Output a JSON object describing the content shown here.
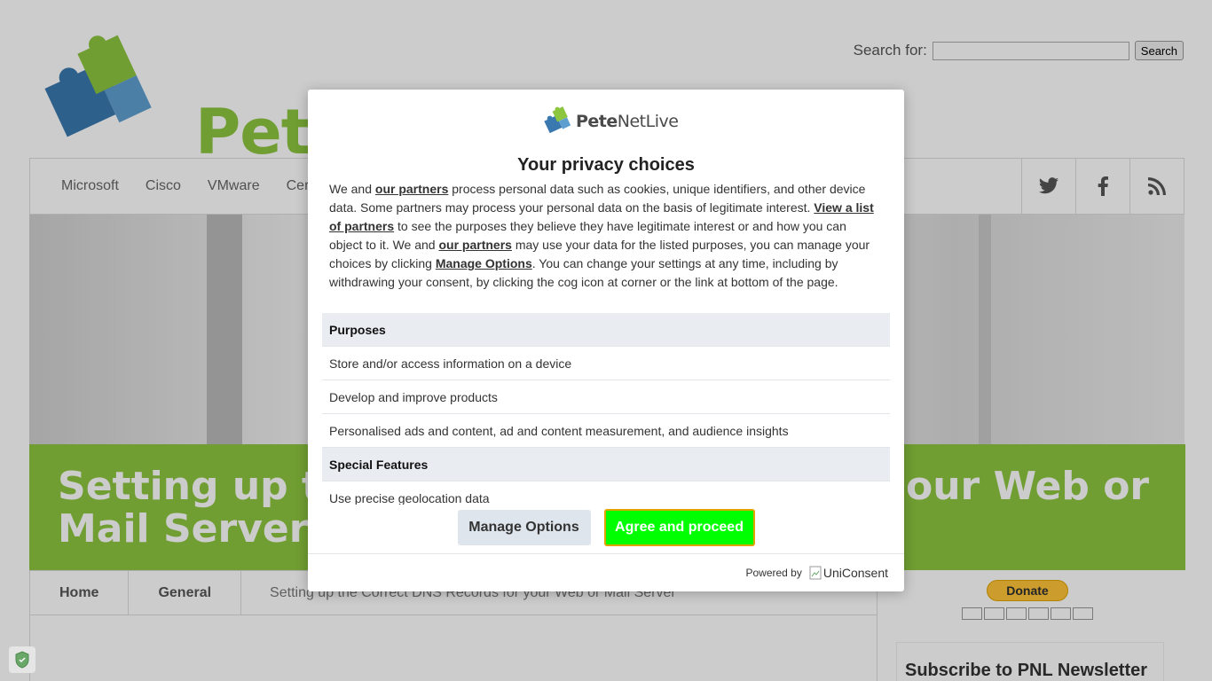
{
  "site": {
    "logo_text": "PeteNetLive",
    "search_label": "Search for:",
    "search_value": "",
    "search_button": "Search",
    "nav": [
      "Microsoft",
      "Cisco",
      "VMware",
      "Cer"
    ],
    "social": [
      "twitter-icon",
      "facebook-icon",
      "rss-icon"
    ],
    "banner_title_line1": "Setting up t",
    "banner_title_line1_right": "our Web or",
    "banner_title_line2": "Mail Server",
    "breadcrumbs": [
      "Home",
      "General"
    ],
    "breadcrumb_current": "Setting up the Correct DNS Records for your Web or Mail Server",
    "donate_label": "Donate",
    "newsletter_title": "Subscribe to PNL Newsletter",
    "colors": {
      "brand_green": "#8cc63f",
      "brand_blue": "#3a78b0"
    }
  },
  "modal": {
    "logo_text_bold": "Pete",
    "logo_text_rest": "NetLive",
    "title": "Your privacy choices",
    "text": {
      "p1": "We and ",
      "link_partners": "our partners",
      "p2": " process personal data such as cookies, unique identifiers, and other device data. Some partners may process your personal data on the basis of legitimate interest. ",
      "link_list": "View a list of partners",
      "p3": " to see the purposes they believe they have legitimate interest or and how you can object to it. We and ",
      "link_partners2": "our partners",
      "p4": " may use your data for the listed purposes, you can manage your choices by clicking ",
      "link_manage": "Manage Options",
      "p5": ". You can change your settings at any time, including by withdrawing your consent, by clicking the cog icon at corner or the link at bottom of the page."
    },
    "purposes_heading": "Purposes",
    "purposes": [
      "Store and/or access information on a device",
      "Develop and improve products",
      "Personalised ads and content, ad and content measurement, and audience insights"
    ],
    "special_heading": "Special Features",
    "special": [
      "Use precise geolocation data"
    ],
    "manage_button": "Manage Options",
    "agree_button": "Agree and proceed",
    "powered_by": "Powered by",
    "uniconsent_alt": "UniConsent",
    "colors": {
      "agree_bg": "#00ff00",
      "agree_border": "#e0a400",
      "manage_bg": "#dfe5ec",
      "header_row_bg": "#e9edf2"
    }
  }
}
